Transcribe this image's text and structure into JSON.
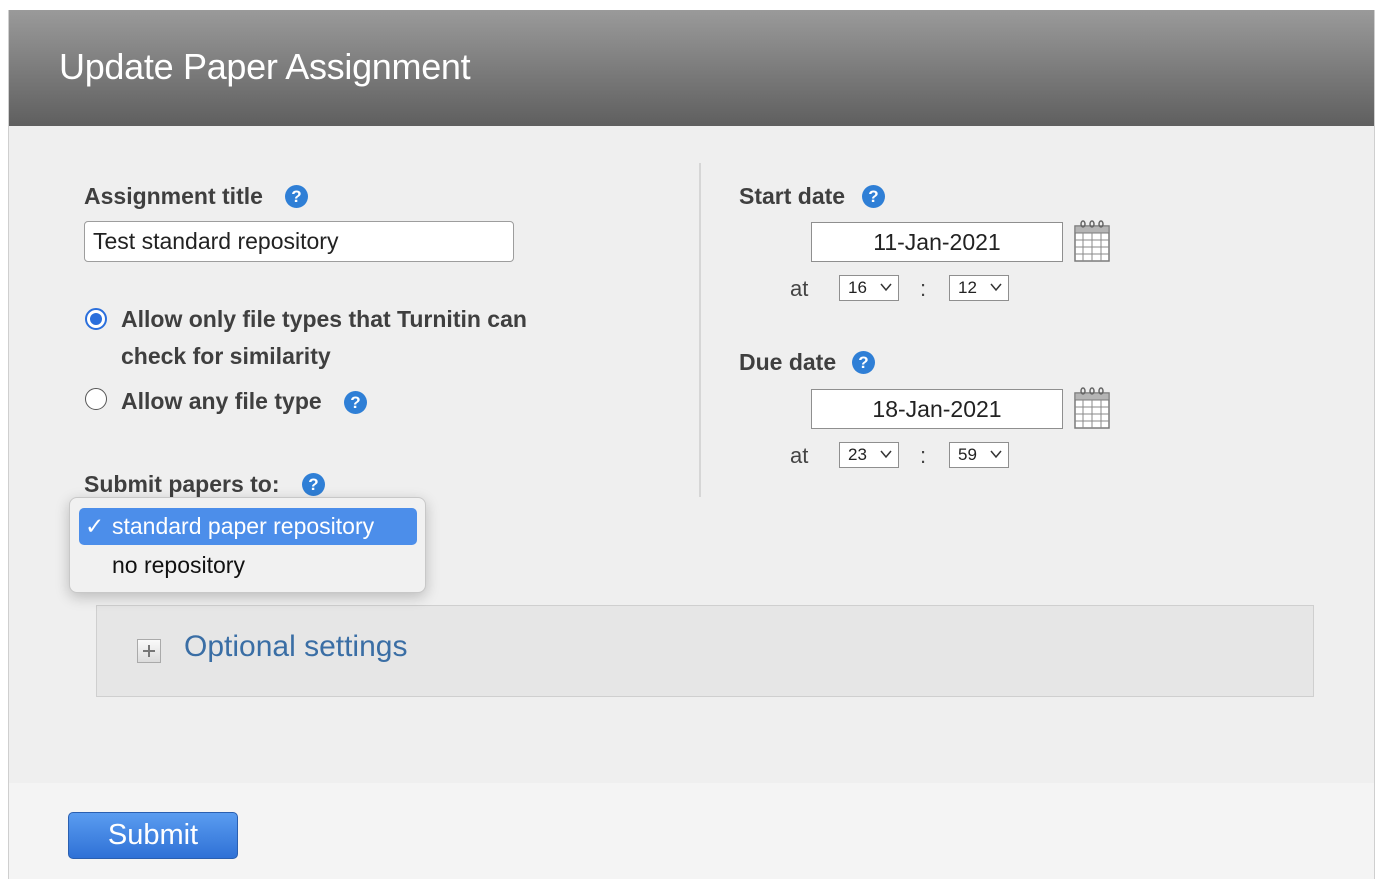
{
  "header": {
    "title": "Update Paper Assignment"
  },
  "assignment": {
    "title_label": "Assignment title",
    "title_value": "Test standard repository"
  },
  "file_types": {
    "option_restricted": "Allow only file types that Turnitin can",
    "option_restricted_line2": "check for similarity",
    "option_any": "Allow any file type",
    "selected": "restricted"
  },
  "submit_to": {
    "label": "Submit papers to:",
    "options": [
      {
        "label": "standard paper repository",
        "selected": true
      },
      {
        "label": "no repository",
        "selected": false
      }
    ],
    "check_mark": "✓"
  },
  "help_glyph": "?",
  "start": {
    "label": "Start date",
    "date": "11-Jan-2021",
    "at": "at",
    "hour": "16",
    "minute": "12"
  },
  "due": {
    "label": "Due date",
    "date": "18-Jan-2021",
    "at": "at",
    "hour": "23",
    "minute": "59"
  },
  "time_separator": ":",
  "optional": {
    "label": "Optional settings"
  },
  "footer": {
    "submit_label": "Submit"
  },
  "icons": {
    "help": "help-icon",
    "calendar": "calendar-icon",
    "expand": "plus-icon",
    "chevron": "chevron-down-icon"
  },
  "colors": {
    "accent": "#2f7fd6",
    "selection": "#4c8eea",
    "link": "#3a6ea5",
    "submit": "#2f71d6"
  }
}
